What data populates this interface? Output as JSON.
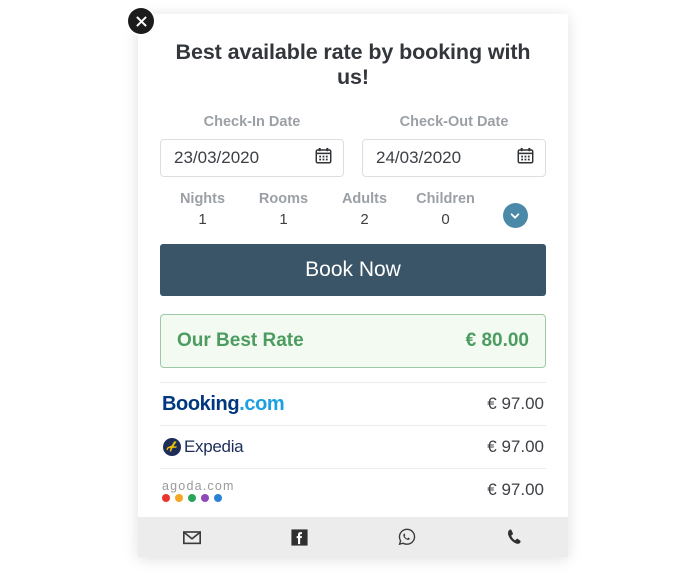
{
  "modal": {
    "close_icon": "close-icon",
    "title": "Best available rate by booking with us!",
    "dates": [
      {
        "label": "Check-In Date",
        "value": "23/03/2020",
        "icon": "calendar-icon"
      },
      {
        "label": "Check-Out Date",
        "value": "24/03/2020",
        "icon": "calendar-icon"
      }
    ],
    "occupancy": [
      {
        "label": "Nights",
        "value": "1"
      },
      {
        "label": "Rooms",
        "value": "1"
      },
      {
        "label": "Adults",
        "value": "2"
      },
      {
        "label": "Children",
        "value": "0"
      }
    ],
    "occupancy_toggle_icon": "chevron-down-icon",
    "book_now_label": "Book Now",
    "best_rate": {
      "label": "Our Best Rate",
      "price": "€ 80.00"
    },
    "competitors": [
      {
        "name_part1": "Booking",
        "name_part2": ".com",
        "logo": "booking-com-logo",
        "price": "€ 97.00"
      },
      {
        "name": "Expedia",
        "logo": "expedia-logo",
        "price": "€ 97.00"
      },
      {
        "name": "agoda.com",
        "logo": "agoda-com-logo",
        "price": "€ 97.00"
      }
    ],
    "footer_icons": [
      {
        "name": "email-icon"
      },
      {
        "name": "facebook-icon"
      },
      {
        "name": "whatsapp-icon"
      },
      {
        "name": "phone-icon"
      }
    ]
  },
  "colors": {
    "book_now_bg": "#3a5567",
    "best_rate_green": "#4d9c5f",
    "best_rate_bg": "#f2faf2",
    "toggle_blue": "#4a8aa8",
    "booking_navy": "#00377f",
    "booking_blue": "#1ca0e3",
    "expedia_navy": "#1c2d5a",
    "expedia_gold": "#f2c300",
    "agoda_dot_red": "#e8352e",
    "agoda_dot_orange": "#f5a623",
    "agoda_dot_green": "#2aa65c",
    "agoda_dot_purple": "#8e4bb5",
    "agoda_dot_blue": "#2b81d6",
    "footer_bg": "#ececec"
  }
}
